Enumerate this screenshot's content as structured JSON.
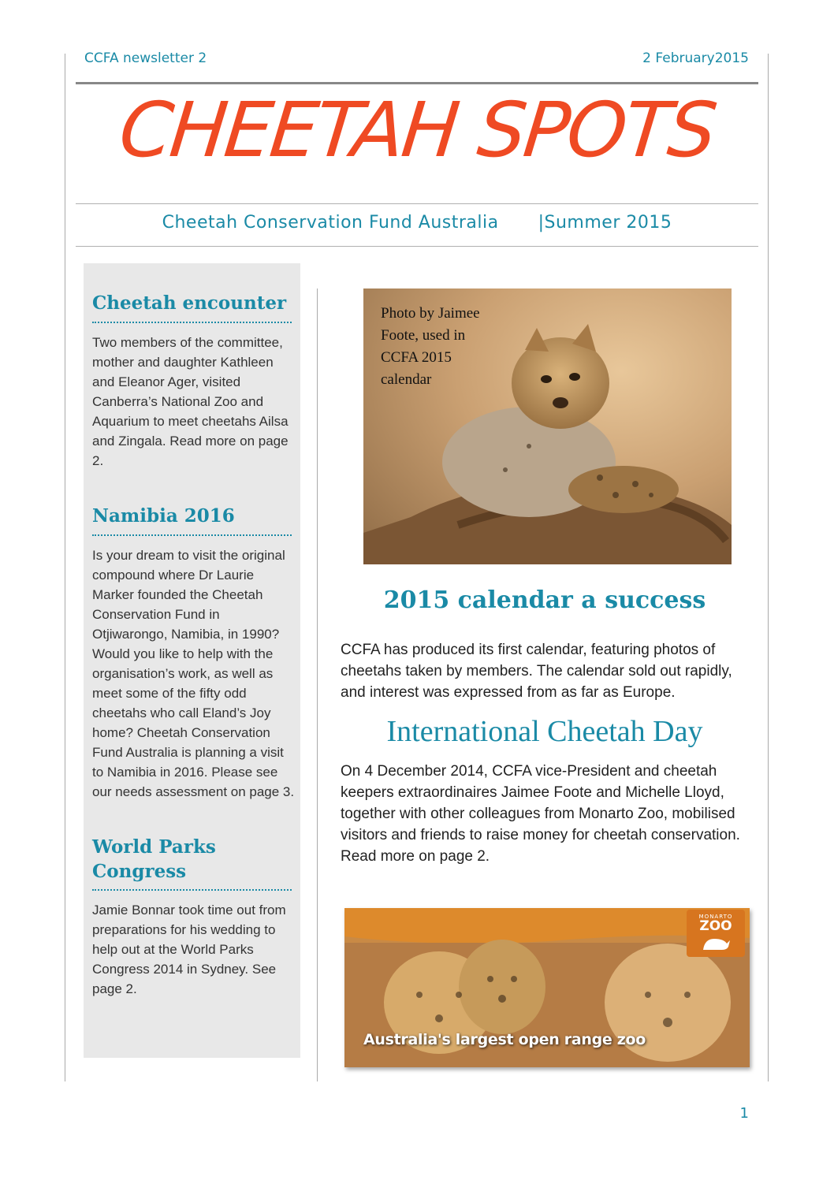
{
  "header": {
    "left": "CCFA newsletter 2",
    "right": "2 February2015"
  },
  "masthead": "CHEETAH SPOTS",
  "subtitle": {
    "org": "Cheetah Conservation Fund Australia",
    "season": "|Summer 2015"
  },
  "sidebar": {
    "sections": [
      {
        "heading": "Cheetah encounter",
        "text": "Two members of the committee, mother and daughter Kathleen and Eleanor Ager, visited Canberra’s National Zoo and Aquarium to meet cheetahs Ailsa and Zingala. Read more on page 2."
      },
      {
        "heading": "Namibia 2016",
        "text": "Is your dream to visit the original compound where Dr Laurie Marker founded the Cheetah Conservation Fund in Otjiwarongo, Namibia, in 1990? Would you like to help with the organisation’s work, as well as meet some of the fifty odd cheetahs who call Eland’s Joy home? Cheetah Conservation Fund Australia is planning a visit to Namibia in 2016. Please see our needs assessment on page 3."
      },
      {
        "heading": "World Parks Congress",
        "text": "Jamie Bonnar took time out from preparations for his wedding to help out at the World Parks Congress 2014 in Sydney. See page 2."
      }
    ]
  },
  "photo": {
    "caption": "Photo by Jaimee Foote, used in CCFA 2015 calendar"
  },
  "articles": [
    {
      "heading": "2015 calendar a success",
      "text": "CCFA has produced its first calendar, featuring photos of cheetahs taken by members. The calendar sold out rapidly, and interest was expressed from as far as Europe."
    },
    {
      "heading": "International Cheetah Day",
      "text": "On 4 December 2014, CCFA vice-President and cheetah keepers extraordinaires Jaimee Foote and Michelle Lloyd, together with other colleagues from Monarto Zoo, mobilised visitors and friends to raise money for cheetah conservation. Read more on page 2."
    }
  ],
  "zoo_banner": {
    "caption": "Australia's largest open range zoo",
    "logo_top": "MONARTO",
    "logo_main": "ZOO"
  },
  "page_number": "1",
  "colors": {
    "accent_teal": "#1a8aa6",
    "masthead_red": "#ef4a23",
    "sidebar_bg": "#e8e8e8"
  }
}
